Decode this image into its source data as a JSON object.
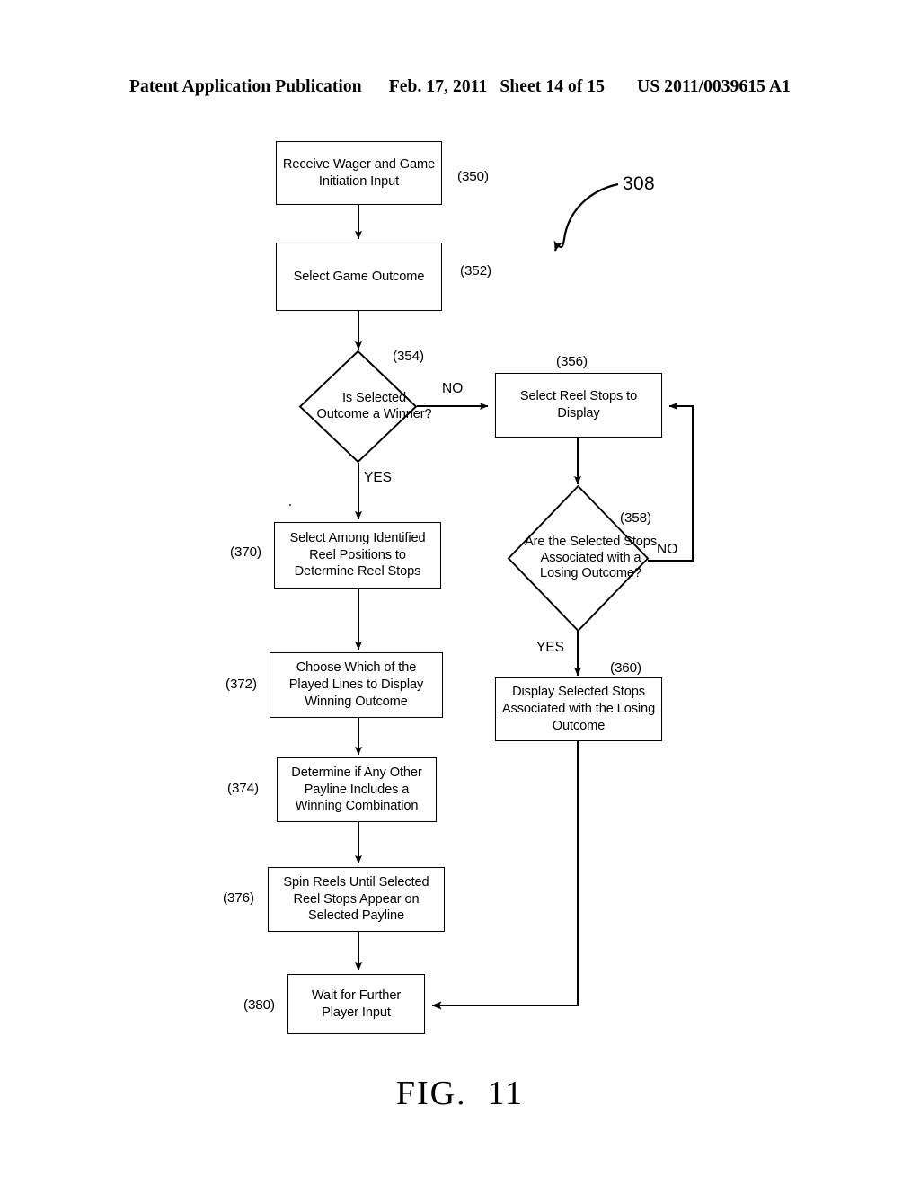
{
  "header": {
    "publication": "Patent Application Publication",
    "date": "Feb. 17, 2011",
    "sheet": "Sheet 14 of 15",
    "docnum": "US 2011/0039615 A1"
  },
  "figure": {
    "caption": "FIG.  11",
    "diagram_ref": "308"
  },
  "nodes": {
    "n350": {
      "text": "Receive Wager and Game Initiation Input",
      "ref": "(350)",
      "type": "process"
    },
    "n352": {
      "text": "Select Game Outcome",
      "ref": "(352)",
      "type": "process"
    },
    "n354": {
      "text": "Is Selected Outcome a Winner?",
      "ref": "(354)",
      "type": "decision"
    },
    "n356": {
      "text": "Select Reel Stops to Display",
      "ref": "(356)",
      "type": "process"
    },
    "n358": {
      "text": "Are the Selected Stops Associated with a Losing Outcome?",
      "ref": "(358)",
      "type": "decision"
    },
    "n360": {
      "text": "Display Selected Stops Associated with the Losing Outcome",
      "ref": "(360)",
      "type": "process"
    },
    "n370": {
      "text": "Select Among Identified Reel Positions to Determine Reel Stops",
      "ref": "(370)",
      "type": "process"
    },
    "n372": {
      "text": "Choose Which of the Played Lines to Display Winning Outcome",
      "ref": "(372)",
      "type": "process"
    },
    "n374": {
      "text": "Determine if Any Other Payline Includes a Winning Combination",
      "ref": "(374)",
      "type": "process"
    },
    "n376": {
      "text": "Spin Reels Until Selected Reel Stops Appear on Selected Payline",
      "ref": "(376)",
      "type": "process"
    },
    "n380": {
      "text": "Wait for Further Player Input",
      "ref": "(380)",
      "type": "process"
    }
  },
  "edges": {
    "e354_no": "NO",
    "e354_yes": "YES",
    "e358_no": "NO",
    "e358_yes": "YES"
  }
}
